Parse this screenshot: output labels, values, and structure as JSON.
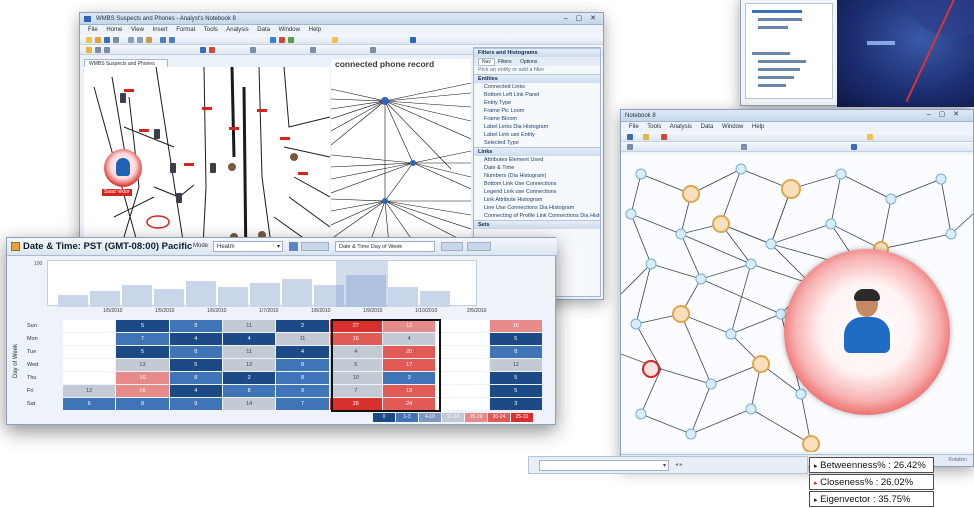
{
  "left_window": {
    "title": "WMBS Suspects and Phones - Analyst's Notebook 8",
    "menu": [
      "File",
      "Home",
      "View",
      "Insert",
      "Format",
      "Tools",
      "Analysis",
      "Data",
      "Window",
      "Help"
    ],
    "tab_label": "WMBS Suspects and Phones",
    "node_label": "Saad Viktor",
    "chart_banner": "connected phone record",
    "filters_panel": {
      "title": "Filters and Histograms",
      "tabs": [
        "Nav",
        "Filters",
        "Options"
      ],
      "search_hint": "Pick an entity or add a filter",
      "sections": [
        {
          "title": "Entities",
          "rows": [
            "Connected Links",
            "Bottom Left Link Panel",
            "Entity Type",
            "Frame Pic Loom",
            "Frame Bloom",
            "Label Links Dia Histogram",
            "Label Link use Entity",
            "Selected Type"
          ]
        },
        {
          "title": "Links",
          "rows": [
            "Attributes Element Used",
            "Date & Time",
            "Numbers (Dia Histogram)",
            "Bottom Link Use Connections",
            "Legend Link use Connections",
            "Link Attribute Histogram",
            "Line Use Connections Dia Histogram",
            "Connecting of Profile Link Connections Dia Histogram"
          ]
        },
        {
          "title": "Sets",
          "rows": []
        }
      ]
    }
  },
  "heatmap_panel": {
    "title": "Date & Time: PST (GMT-08:00) Pacific",
    "mode_label": "Mode",
    "mode_value": "Heatm",
    "group_label": "Date & Time Day of Week",
    "y_axis_label": "Day of Week",
    "histogram_top_tick": "100",
    "date_ticks": [
      "1/5/2010",
      "1/5/2010",
      "1/6/2010",
      "1/7/2010",
      "1/8/2010",
      "1/9/2010",
      "1/10/2010",
      "2/5/2010",
      "2/7/2010",
      "2/9/2010"
    ],
    "days": [
      "Sun",
      "Mon",
      "Tue",
      "Wed",
      "Thu",
      "Fri",
      "Sat"
    ],
    "cell_values": [
      [
        "",
        "5",
        "8",
        "11",
        "2",
        "27",
        "12",
        "",
        "16"
      ],
      [
        "",
        "7",
        "4",
        "4",
        "11",
        "16",
        "4",
        "",
        "5"
      ],
      [
        "",
        "5",
        "8",
        "11",
        "4",
        "4",
        "20",
        "",
        "8"
      ],
      [
        "",
        "13",
        "5",
        "12",
        "8",
        "5",
        "17",
        "",
        "12"
      ],
      [
        "",
        "16",
        "8",
        "2",
        "8",
        "10",
        "3",
        "",
        "5"
      ],
      [
        "12",
        "16",
        "4",
        "8",
        "9",
        "7",
        "19",
        "",
        "5"
      ],
      [
        "6",
        "8",
        "9",
        "14",
        "7",
        "28",
        "24",
        "",
        "3"
      ]
    ],
    "legend_scale": [
      "0",
      "1-3",
      "4-10",
      "11-14",
      "15-19",
      "20-24",
      "25-31"
    ]
  },
  "right_window": {
    "title": "Notebook 8",
    "menu": [
      "File",
      "Tools",
      "Analysis",
      "Data",
      "Window",
      "Help"
    ],
    "status_right": "Rotation"
  },
  "metrics": [
    {
      "label": "Betweenness%",
      "value": "26.42%"
    },
    {
      "label": "Closeness%",
      "value": "26.02%"
    },
    {
      "label": "Eigenvector",
      "value": "35.75%"
    }
  ],
  "colors": {
    "accent_red": "#d9231d",
    "heat_blue_dark": "#1c4a86",
    "heat_blue": "#3f74b6",
    "heat_grey": "#c3cad4",
    "heat_pink": "#e68a8a",
    "heat_red": "#d8302c"
  }
}
